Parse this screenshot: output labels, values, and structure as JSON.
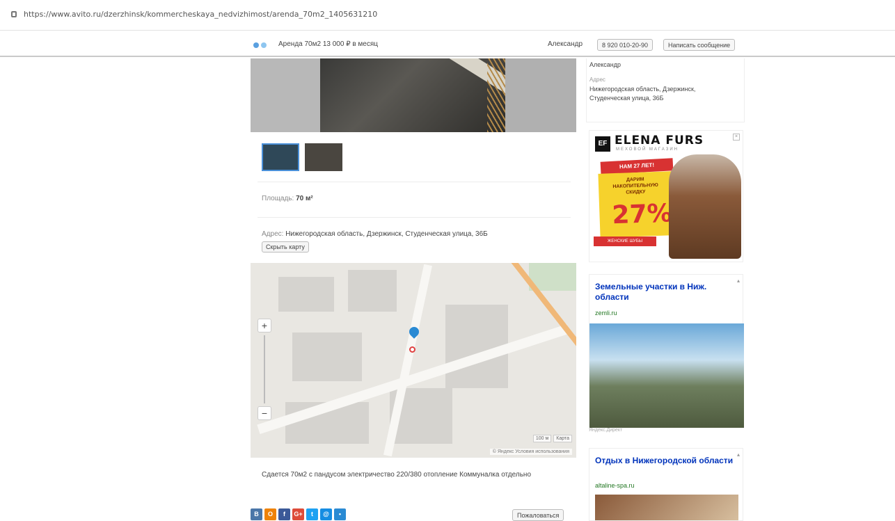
{
  "browser": {
    "url": "https://www.avito.ru/dzerzhinsk/kommercheskaya_nedvizhimost/arenda_70m2_1405631210"
  },
  "header": {
    "title": "Аренда 70м2   13 000 ₽ в месяц",
    "seller": "Александр",
    "phone_label": "8 920 010-20-90",
    "message_label": "Написать сообщение"
  },
  "listing": {
    "area_label": "Площадь:",
    "area_value": "70 м²",
    "address_label": "Адрес:",
    "address_value": "Нижегородская область, Дзержинск, Студенческая улица, 36Б",
    "hide_map_label": "Скрыть карту",
    "description": "Сдается 70м2 с пандусом электричество 220/380 отопление Коммуналка отдельно",
    "complain_label": "Пожаловаться",
    "map_attribution": "© Яндекс  Условия использования",
    "map_scale": [
      "100 м",
      "Карта"
    ],
    "zoom_in": "+",
    "zoom_out": "−"
  },
  "share": {
    "icons": [
      "В",
      "О",
      "f",
      "G+",
      "t",
      "@",
      "•"
    ],
    "colors": [
      "#4a76a8",
      "#ee8208",
      "#3b5998",
      "#dd4b39",
      "#1da1f2",
      "#168de2",
      "#2a8ad3"
    ]
  },
  "sidebar": {
    "seller_name": "Александр",
    "address_label": "Адрес",
    "address_value": "Нижегородская область, Дзержинск, Студенческая улица, 36Б",
    "ad1": {
      "brand": "ELENA FURS",
      "brand_logo": "EF",
      "tagline": "МЕХОВОЙ МАГАЗИН",
      "ribbon": "НАМ 27 ЛЕТ!",
      "gift_text": "ДАРИМ НАКОПИТЕЛЬНУЮ СКИДКУ",
      "percent": "27%",
      "bottom_ribbon": "ЖЕНСКИЕ ШУБЫ"
    },
    "ad2": {
      "title": "Земельные участки в Ниж. области",
      "domain": "zemli.ru",
      "footer": "Яндекс.Директ"
    },
    "ad3": {
      "title": "Отдых в Нижегородской области",
      "domain": "altaline-spa.ru"
    }
  }
}
